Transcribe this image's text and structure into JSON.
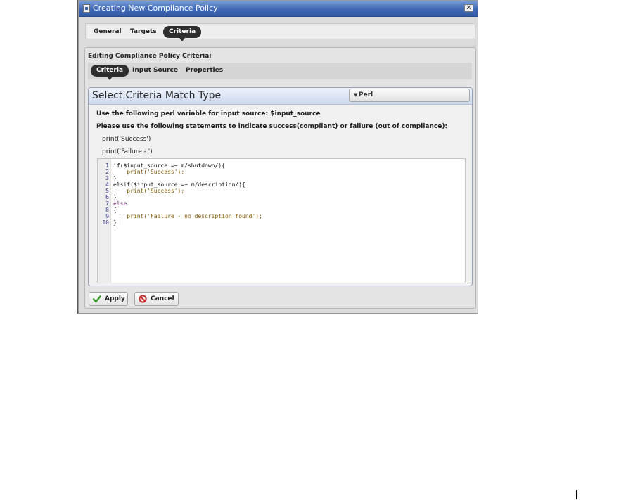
{
  "window": {
    "title": "Creating New Compliance Policy",
    "close_glyph": "✕"
  },
  "tabs": [
    {
      "label": "General",
      "active": false
    },
    {
      "label": "Targets",
      "active": false
    },
    {
      "label": "Criteria",
      "active": true
    }
  ],
  "panel": {
    "heading": "Editing Compliance Policy Criteria:",
    "subtabs": [
      {
        "label": "Criteria",
        "active": true
      },
      {
        "label": "Input Source",
        "active": false
      },
      {
        "label": "Properties",
        "active": false
      }
    ]
  },
  "criteria": {
    "title": "Select Criteria Match Type",
    "match_type": "Perl",
    "info_line_1": "Use the following perl variable for input source: $input_source",
    "info_line_2": "Please use the following statements to indicate success(compliant) or failure (out of compliance):",
    "example_success": "print('Success')",
    "example_failure": "print('Failure - ')"
  },
  "code": {
    "lines": [
      {
        "n": "1",
        "text": "if($input_source =~ m/shutdown/){"
      },
      {
        "n": "2",
        "text": "    print('Success');"
      },
      {
        "n": "3",
        "text": "}"
      },
      {
        "n": "4",
        "text": "elsif($input_source =~ m/description/){"
      },
      {
        "n": "5",
        "text": "    print('Success');"
      },
      {
        "n": "6",
        "text": "}"
      },
      {
        "n": "7",
        "text": "else"
      },
      {
        "n": "8",
        "text": "{"
      },
      {
        "n": "9",
        "text": "    print('Failure - no description found');"
      },
      {
        "n": "10",
        "text": "}"
      }
    ]
  },
  "buttons": {
    "apply_label": "Apply",
    "cancel_label": "Cancel"
  },
  "colors": {
    "titlebar": "#3f68b5",
    "active_tab": "#2e2e2e",
    "apply_icon": "#3a9a2a",
    "cancel_icon": "#c42a2a"
  },
  "icons": {
    "window_icon": "document-icon",
    "close": "close-icon",
    "dropdown": "chevron-down-icon",
    "apply": "checkmark-icon",
    "cancel": "no-entry-icon"
  }
}
